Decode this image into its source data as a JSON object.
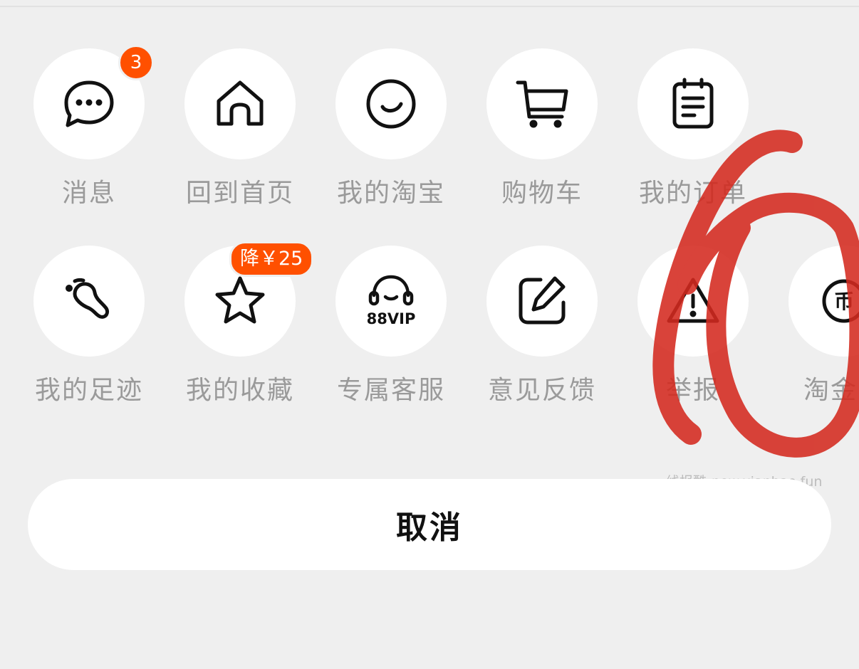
{
  "menu": {
    "row1": [
      {
        "label": "消息",
        "icon": "chat-bubble-icon",
        "badge": "3"
      },
      {
        "label": "回到首页",
        "icon": "home-icon"
      },
      {
        "label": "我的淘宝",
        "icon": "smile-face-icon"
      },
      {
        "label": "购物车",
        "icon": "shopping-cart-icon"
      },
      {
        "label": "我的订单",
        "icon": "clipboard-icon"
      }
    ],
    "row2": [
      {
        "label": "我的足迹",
        "icon": "footprint-icon"
      },
      {
        "label": "我的收藏",
        "icon": "star-icon",
        "badge": "降￥25"
      },
      {
        "label": "专属客服",
        "icon": "headset-88vip-icon",
        "icon_text": "88VIP"
      },
      {
        "label": "意见反馈",
        "icon": "edit-note-icon"
      },
      {
        "label": "举报",
        "icon": "warning-triangle-icon"
      },
      {
        "label": "淘金币",
        "icon": "coin-icon",
        "icon_text": "币"
      }
    ]
  },
  "watermark": "线报酷-new.xianbao.fun",
  "cancel_label": "取消",
  "colors": {
    "background": "#efefef",
    "accent": "#ff5000",
    "annotation": "#d42a1f"
  }
}
